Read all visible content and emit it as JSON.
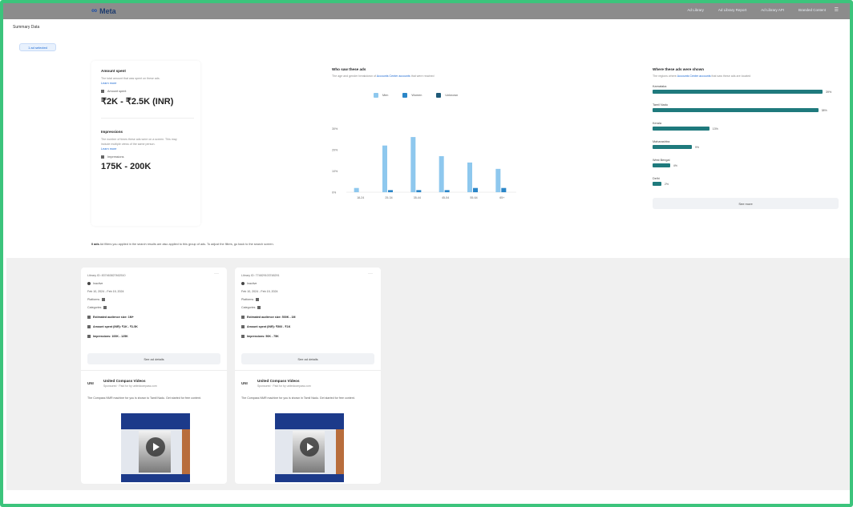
{
  "header": {
    "logo": "Meta",
    "nav": [
      "Ad Library",
      "Ad Library Report",
      "Ad Library API",
      "Branded Content"
    ]
  },
  "page": {
    "title": "Summary Data",
    "filter_chip": "1 ad selected"
  },
  "left_panel": {
    "amount_spent": {
      "title": "Amount spent",
      "desc": "The total amount that was spent on these ads.",
      "learn": "Learn more",
      "label": "Amount spent",
      "value": "₹2K - ₹2.5K (INR)"
    },
    "impressions": {
      "title": "Impressions",
      "desc": "The number of times these ads were on a screen. This may include multiple views of the same person.",
      "learn": "Learn more",
      "label": "Impressions",
      "value": "175K - 200K"
    }
  },
  "chart_panel": {
    "title": "Who saw these ads",
    "desc_prefix": "The age and gender breakdown of",
    "desc_link": "Accounts Center accounts",
    "desc_suffix": "that were reached",
    "legend": [
      "Men",
      "Women",
      "Unknown"
    ]
  },
  "chart_data": {
    "type": "bar",
    "categories": [
      "18-24",
      "25-34",
      "35-44",
      "45-54",
      "55-64",
      "65+"
    ],
    "series": [
      {
        "name": "Men",
        "values": [
          2,
          22,
          26,
          17,
          14,
          11
        ]
      },
      {
        "name": "Women",
        "values": [
          0,
          1,
          1,
          1,
          2,
          2
        ]
      },
      {
        "name": "Unknown",
        "values": [
          0,
          0,
          0,
          0,
          0,
          0
        ]
      }
    ],
    "ylim": [
      0,
      40
    ],
    "yticks": [
      "0%",
      "10%",
      "20%",
      "30%"
    ],
    "colors": [
      "#8ec8ee",
      "#2b86c8",
      "#1f5a78"
    ]
  },
  "region_panel": {
    "title": "Where these ads were shown",
    "desc_prefix": "The regions where",
    "desc_link": "Accounts Center accounts",
    "desc_suffix": "that saw these ads are located",
    "rows": [
      {
        "name": "Karnataka",
        "pct": "39%",
        "value": 39
      },
      {
        "name": "Tamil Nadu",
        "pct": "38%",
        "value": 38
      },
      {
        "name": "Kerala",
        "pct": "13%",
        "value": 13
      },
      {
        "name": "Maharashtra",
        "pct": "9%",
        "value": 9
      },
      {
        "name": "West Bengal",
        "pct": "4%",
        "value": 4
      },
      {
        "name": "Delhi",
        "pct": "2%",
        "value": 2
      }
    ],
    "see_more": "See more",
    "bar_color": "#1f7a7d"
  },
  "note": {
    "bold": "0 ads",
    "text": "Ad filters you applied in the search results are also applied to this group of ads. To adjust the filters, go back to the search screen."
  },
  "ads": [
    {
      "id": "Library ID: 837463827462510",
      "status": "Inactive",
      "dates": "Feb 10, 2024 - Feb 19, 2024",
      "platforms": "Platforms",
      "categories": "Categories",
      "audience": "Estimated audience size: 1M+",
      "spend": "Amount spent (INR): ₹1K - ₹1.5K",
      "impressions": "Impressions: 100K - 125K",
      "details": "See ad details",
      "advertiser": "United Compass Videos",
      "advertiser_sub": "Sponsored · Paid for by unitedcompass.com",
      "logo": "UNI",
      "copy": "The Compass NMR machine for you is shown to Tamil Nadu. Get started for free content."
    },
    {
      "id": "Library ID: 774829103748291",
      "status": "Inactive",
      "dates": "Feb 10, 2024 - Feb 19, 2024",
      "platforms": "Platforms",
      "categories": "Categories",
      "audience": "Estimated audience size: 500K - 1M",
      "spend": "Amount spent (INR): ₹500 - ₹1K",
      "impressions": "Impressions: 50K - 75K",
      "details": "See ad details",
      "advertiser": "United Compass Videos",
      "advertiser_sub": "Sponsored · Paid for by unitedcompass.com",
      "logo": "UNI",
      "copy": "The Compass NMR machine for you is shown in Tamil Nadu. Get started for free content."
    }
  ]
}
